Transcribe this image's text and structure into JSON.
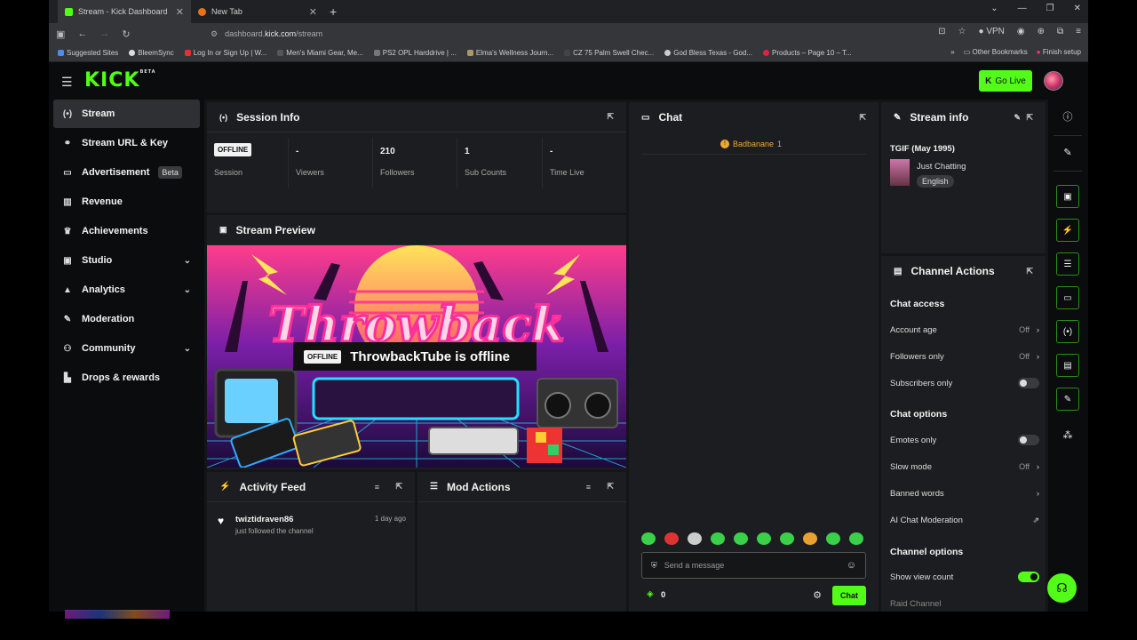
{
  "browser": {
    "tabs": [
      {
        "title": "Stream - Kick Dashboard",
        "color": "#53fc18"
      },
      {
        "title": "New Tab",
        "color": "#e8711a"
      }
    ],
    "url_prefix": "dashboard.",
    "url_domain": "kick.com",
    "url_path": "/stream",
    "vpn_label": "VPN",
    "bookmarks": [
      "Suggested Sites",
      "BleemSync",
      "Log In or Sign Up | W...",
      "Men's Miami Gear, Me...",
      "PS2 OPL Harddrive | ...",
      "Elma's Wellness Journ...",
      "CZ 75 Palm Swell Chec...",
      "God Bless Texas - God...",
      "Products – Page 10 – T..."
    ],
    "other_bookmarks": "Other Bookmarks",
    "finish_setup": "Finish setup"
  },
  "header": {
    "logo": "KICK",
    "logo_sup": "BETA",
    "go_live_label": "Go Live"
  },
  "sidebar": {
    "items": [
      {
        "label": "Stream"
      },
      {
        "label": "Stream URL & Key"
      },
      {
        "label": "Advertisement",
        "badge": "Beta"
      },
      {
        "label": "Revenue"
      },
      {
        "label": "Achievements"
      },
      {
        "label": "Studio"
      },
      {
        "label": "Analytics"
      },
      {
        "label": "Moderation"
      },
      {
        "label": "Community"
      },
      {
        "label": "Drops & rewards"
      }
    ]
  },
  "session": {
    "title": "Session Info",
    "status_badge": "OFFLINE",
    "stats": [
      {
        "value": "-",
        "label": "Viewers"
      },
      {
        "value": "210",
        "label": "Followers"
      },
      {
        "value": "1",
        "label": "Sub Counts"
      },
      {
        "value": "-",
        "label": "Time Live"
      }
    ],
    "session_label": "Session"
  },
  "preview": {
    "title": "Stream Preview",
    "offline_badge": "OFFLINE",
    "offline_text": "ThrowbackTube is offline",
    "artwork_text": "Throwback"
  },
  "activity": {
    "title": "Activity Feed",
    "items": [
      {
        "user": "twiztidraven86",
        "time": "1 day ago",
        "text": "just followed the channel"
      }
    ]
  },
  "mod_actions": {
    "title": "Mod Actions"
  },
  "chat": {
    "title": "Chat",
    "pinned_user": "Badbanane",
    "pinned_count": "1",
    "input_placeholder": "Send a message",
    "points": "0",
    "send_label": "Chat"
  },
  "stream_info": {
    "title": "Stream info",
    "stream_title": "TGIF (May 1995)",
    "category": "Just Chatting",
    "language": "English"
  },
  "channel_actions": {
    "title": "Channel Actions",
    "chat_access_heading": "Chat access",
    "account_age": {
      "label": "Account age",
      "value": "Off"
    },
    "followers_only": {
      "label": "Followers only",
      "value": "Off"
    },
    "subscribers_only": {
      "label": "Subscribers only"
    },
    "chat_options_heading": "Chat options",
    "emotes_only": {
      "label": "Emotes only"
    },
    "slow_mode": {
      "label": "Slow mode",
      "value": "Off"
    },
    "banned_words": {
      "label": "Banned words"
    },
    "ai_moderation": {
      "label": "AI Chat Moderation"
    },
    "channel_options_heading": "Channel options",
    "show_view_count": {
      "label": "Show view count"
    },
    "raid_channel": {
      "label": "Raid Channel"
    }
  },
  "colors": {
    "accent": "#53fc18",
    "panel": "#1c1d20",
    "bg": "#141517"
  }
}
